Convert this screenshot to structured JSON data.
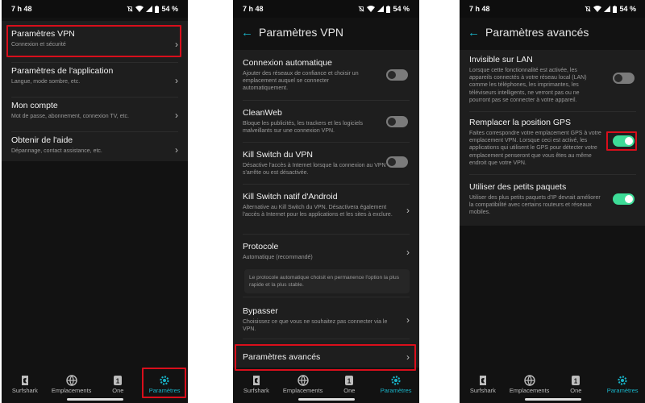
{
  "status": {
    "time": "7 h 48",
    "battery": "54 %"
  },
  "screen1": {
    "items": [
      {
        "title": "Paramètres VPN",
        "subtitle": "Connexion et sécurité"
      },
      {
        "title": "Paramètres de l'application",
        "subtitle": "Langue, mode sombre, etc."
      },
      {
        "title": "Mon compte",
        "subtitle": "Mot de passe, abonnement, connexion TV, etc."
      },
      {
        "title": "Obtenir de l'aide",
        "subtitle": "Dépannage, contact assistance, etc."
      }
    ]
  },
  "screen2": {
    "title": "Paramètres VPN",
    "items": [
      {
        "title": "Connexion automatique",
        "subtitle": "Ajouter des réseaux de confiance et choisir un emplacement auquel se connecter automatiquement.",
        "toggle": "off"
      },
      {
        "title": "CleanWeb",
        "subtitle": "Bloque les publicités, les trackers et les logiciels malveillants sur une connexion VPN.",
        "toggle": "off"
      },
      {
        "title": "Kill Switch du VPN",
        "subtitle": "Désactive l'accès à Internet lorsque la connexion au VPN s'arrête ou est désactivée.",
        "toggle": "off"
      },
      {
        "title": "Kill Switch natif d'Android",
        "subtitle": "Alternative au Kill Switch du VPN. Désactivera également l'accès à Internet pour les applications et les sites à exclure."
      },
      {
        "title": "Protocole",
        "subtitle": "Automatique (recommandé)"
      },
      {
        "title": "Bypasser",
        "subtitle": "Choisissez ce que vous ne souhaitez pas connecter via le VPN."
      },
      {
        "title": "Paramètres avancés",
        "subtitle": ""
      }
    ],
    "protocol_note": "Le protocole automatique choisit en permanence l'option la plus rapide et la plus stable."
  },
  "screen3": {
    "title": "Paramètres avancés",
    "items": [
      {
        "title": "Invisible sur LAN",
        "subtitle": "Lorsque cette fonctionnalité est activée, les appareils connectés à votre réseau local (LAN) comme les téléphones, les imprimantes, les téléviseurs intelligents, ne verront pas ou ne pourront pas se connecter à votre appareil.",
        "toggle": "off"
      },
      {
        "title": "Remplacer la position GPS",
        "subtitle": "Faites correspondre votre emplacement GPS à votre emplacement VPN. Lorsque ceci est activé, les applications qui utilisent le GPS pour détecter votre emplacement penseront que vous êtes au même endroit que votre VPN.",
        "toggle": "on"
      },
      {
        "title": "Utiliser des petits paquets",
        "subtitle": "Utiliser des plus petits paquets d'IP devrait améliorer la compatibilité avec certains routeurs et réseaux mobiles.",
        "toggle": "on"
      }
    ]
  },
  "nav": {
    "items": [
      "Surfshark",
      "Emplacements",
      "One",
      "Paramètres"
    ],
    "active": "Paramètres",
    "one_badge": "1"
  },
  "colors": {
    "accent": "#19b5c9",
    "toggle_on": "#3ddc97",
    "highlight": "#d90e1b",
    "background": "#121212",
    "card": "#1e1e1e"
  },
  "icons": [
    "wifi-icon",
    "cellular-signal-icon",
    "battery-icon",
    "chevron-right-icon",
    "back-arrow-icon",
    "surfshark-logo-icon",
    "globe-icon",
    "one-badge-icon",
    "gear-icon"
  ]
}
